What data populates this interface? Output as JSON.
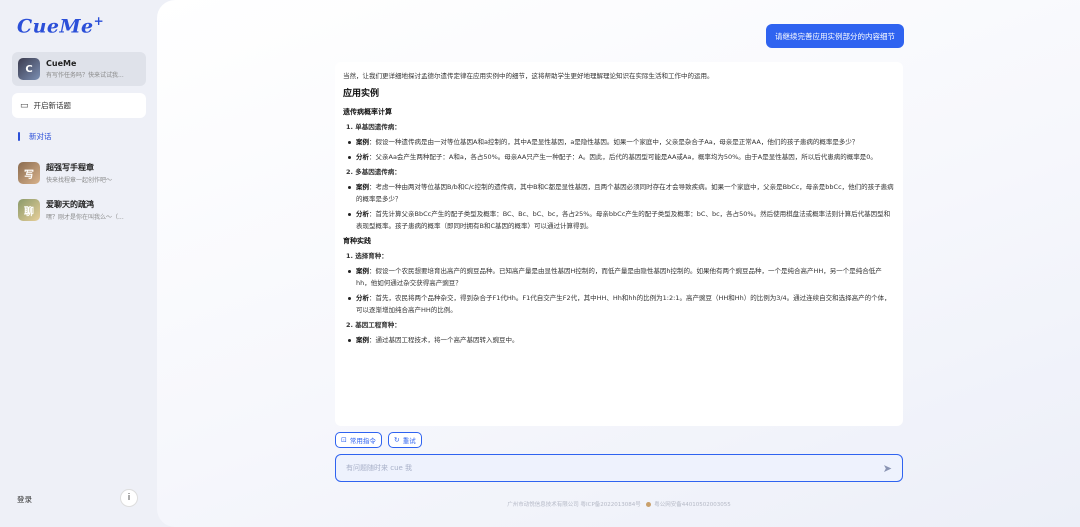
{
  "app": {
    "logo": "CueMe"
  },
  "sidebar": {
    "active_agent": {
      "name": "CueMe",
      "subtitle": "有写作任务吗？快来试试我..."
    },
    "new_topic_label": "开启新话题",
    "current_conversation": "新对话",
    "agents": [
      {
        "name": "超强写手程章",
        "subtitle": "快来找程章一起创作吧～"
      },
      {
        "name": "爱聊天的疏鸿",
        "subtitle": "嘿？刚才是你在叫我么～（..."
      }
    ],
    "login_label": "登录",
    "info_icon": "info-icon"
  },
  "chat": {
    "user_message": "请继续完善应用实例部分的内容细节",
    "answer": {
      "intro": "当然，让我们更详细地探讨孟德尔遗传定律在应用实例中的细节，这将帮助学生更好地理解理论知识在实际生活和工作中的运用。",
      "heading": "应用实例",
      "section1_title": "遗传病概率计算",
      "s1_item1_title": "1. 单基因遗传病：",
      "s1_item1_case_label": "案例",
      "s1_item1_case": "：假设一种遗传病是由一对等位基因A和a控制的，其中A是显性基因，a是隐性基因。如果一个家庭中，父亲是杂合子Aa，母亲是正常AA，他们的孩子患病的概率是多少？",
      "s1_item1_analysis_label": "分析",
      "s1_item1_analysis": "：父亲Aa会产生两种配子：A和a，各占50%。母亲AA只产生一种配子：A。因此，后代的基因型可能是AA或Aa，概率均为50%。由于A是显性基因，所以后代患病的概率是0。",
      "s1_item2_title": "2. 多基因遗传病：",
      "s1_item2_case_label": "案例",
      "s1_item2_case": "：考虑一种由两对等位基因B/b和C/c控制的遗传病，其中B和C都是显性基因，且两个基因必须同时存在才会导致疾病。如果一个家庭中，父亲是BbCc，母亲是bbCc，他们的孩子患病的概率是多少？",
      "s1_item2_analysis_label": "分析",
      "s1_item2_analysis": "：首先计算父亲BbCc产生的配子类型及概率：BC、Bc、bC、bc，各占25%。母亲bbCc产生的配子类型及概率：bC、bc，各占50%。然后使用棋盘法或概率法则计算后代基因型和表现型概率。孩子患病的概率（即同时拥有B和C基因的概率）可以通过计算得到。",
      "section2_title": "育种实践",
      "s2_item1_title": "1. 选择育种：",
      "s2_item1_case_label": "案例",
      "s2_item1_case": "：假设一个农民想要培育出高产的豌豆品种。已知高产量是由显性基因H控制的，而低产量是由隐性基因h控制的。如果他有两个豌豆品种，一个是纯合高产HH，另一个是纯合低产hh，他如何通过杂交获得高产豌豆？",
      "s2_item1_analysis_label": "分析",
      "s2_item1_analysis": "：首先，农民将两个品种杂交，得到杂合子F1代Hh。F1代自交产生F2代，其中HH、Hh和hh的比例为1:2:1。高产豌豆（HH和Hh）的比例为3/4。通过连续自交和选择高产的个体，可以逐渐增加纯合高产HH的比例。",
      "s2_item2_title": "2. 基因工程育种：",
      "s2_item2_case_label": "案例",
      "s2_item2_case": "：通过基因工程技术，将一个高产基因转入豌豆中。"
    },
    "chips": {
      "commands": "常用指令",
      "retry": "重试"
    },
    "input_placeholder": "有问题随时来 cue 我",
    "footer": "广州市动悦信息技术有限公司 粤ICP备2022013084号",
    "footer2": "粤公网安备44010502003055"
  }
}
